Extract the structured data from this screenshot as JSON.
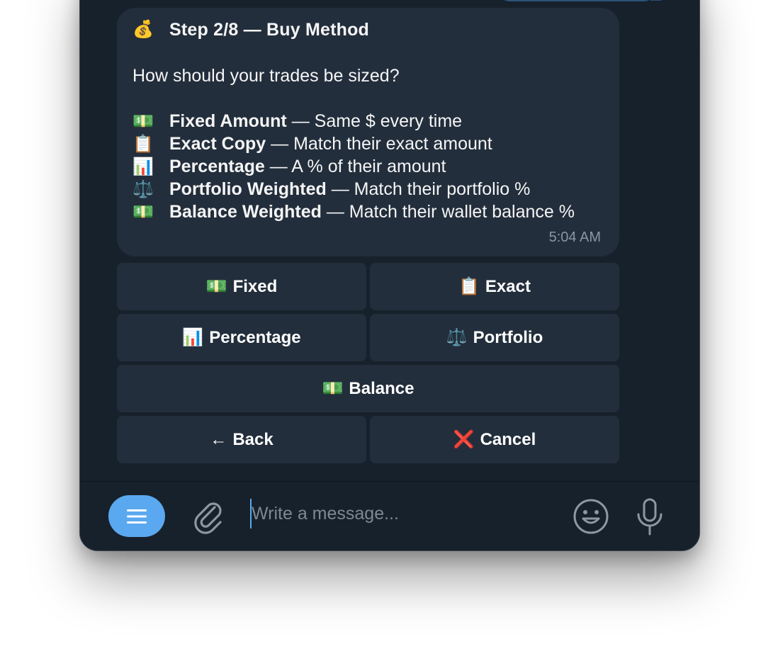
{
  "message": {
    "title_emoji": "💰",
    "title": "Step 2/8 — Buy Method",
    "question": "How should your trades be sized?",
    "options": [
      {
        "icon": "💵",
        "name": "Fixed Amount",
        "desc": " — Same $ every time"
      },
      {
        "icon": "📋",
        "name": "Exact Copy",
        "desc": " — Match their exact amount"
      },
      {
        "icon": "📊",
        "name": "Percentage",
        "desc": " — A % of their amount"
      },
      {
        "icon": "⚖️",
        "name": "Portfolio Weighted",
        "desc": " — Match their portfolio %"
      },
      {
        "icon": "💵",
        "name": "Balance Weighted",
        "desc": " — Match their wallet balance %"
      }
    ],
    "time": "5:04 AM"
  },
  "keyboard": {
    "fixed": {
      "icon": "💵",
      "label": "Fixed"
    },
    "exact": {
      "icon": "📋",
      "label": "Exact"
    },
    "percentage": {
      "icon": "📊",
      "label": "Percentage"
    },
    "portfolio": {
      "icon": "⚖️",
      "label": "Portfolio"
    },
    "balance": {
      "icon": "💵",
      "label": "Balance"
    },
    "back": {
      "icon": "←",
      "label": "Back"
    },
    "cancel": {
      "icon": "❌",
      "label": "Cancel"
    }
  },
  "composer": {
    "placeholder": "Write a message...",
    "menu_icon": "menu-icon",
    "attach_icon": "paperclip-icon",
    "emoji_icon": "smiley-icon",
    "mic_icon": "microphone-icon"
  },
  "colors": {
    "background": "#17212b",
    "bubble": "#232e3c",
    "accent": "#5aa8f0",
    "outgoing": "#2b5278"
  }
}
